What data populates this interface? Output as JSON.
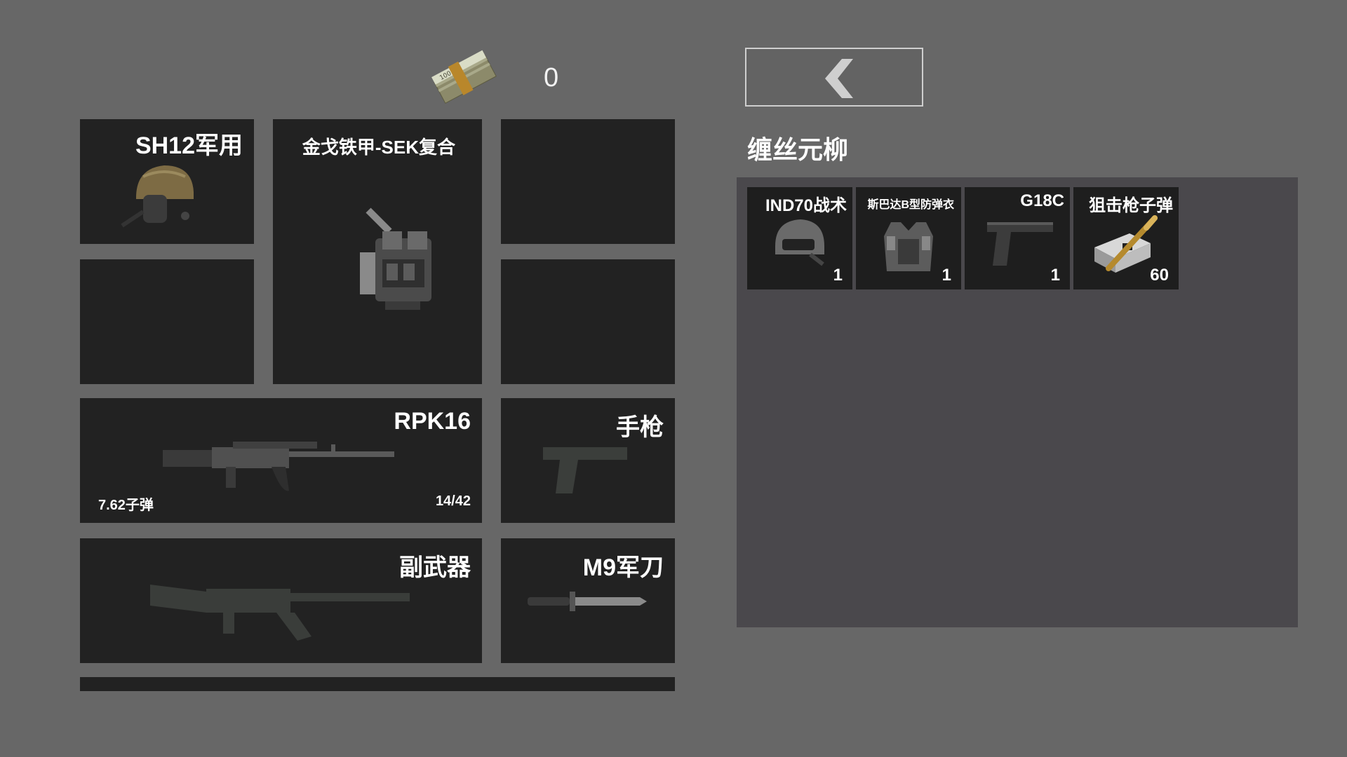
{
  "money": {
    "icon": "cash-stack-icon",
    "amount": "0"
  },
  "back_button": {
    "icon": "chevron-left-icon"
  },
  "loot_title": "缠丝元柳",
  "equipment": {
    "helmet": {
      "label": "SH12军用",
      "icon": "helmet-icon"
    },
    "armor": {
      "label": "金戈铁甲-SEK复合",
      "icon": "body-armor-icon"
    },
    "primary": {
      "label": "RPK16",
      "icon": "rifle-icon",
      "ammo_type": "7.62子弹",
      "ammo_count": "14/42"
    },
    "pistol": {
      "label": "手枪",
      "icon": "pistol-icon"
    },
    "secondary": {
      "label": "副武器",
      "icon": "rifle-silhouette-icon"
    },
    "melee": {
      "label": "M9军刀",
      "icon": "knife-icon"
    }
  },
  "loot_items": [
    {
      "name": "IND70战术",
      "count": "1",
      "icon": "tactical-helmet-icon"
    },
    {
      "name": "斯巴达B型防弹衣",
      "count": "1",
      "icon": "vest-icon"
    },
    {
      "name": "G18C",
      "count": "1",
      "icon": "pistol-icon"
    },
    {
      "name": "狙击枪子弹",
      "count": "60",
      "icon": "ammo-box-icon"
    }
  ],
  "colors": {
    "background": "#676767",
    "slot": "#222222",
    "panel": "#4a484c"
  }
}
